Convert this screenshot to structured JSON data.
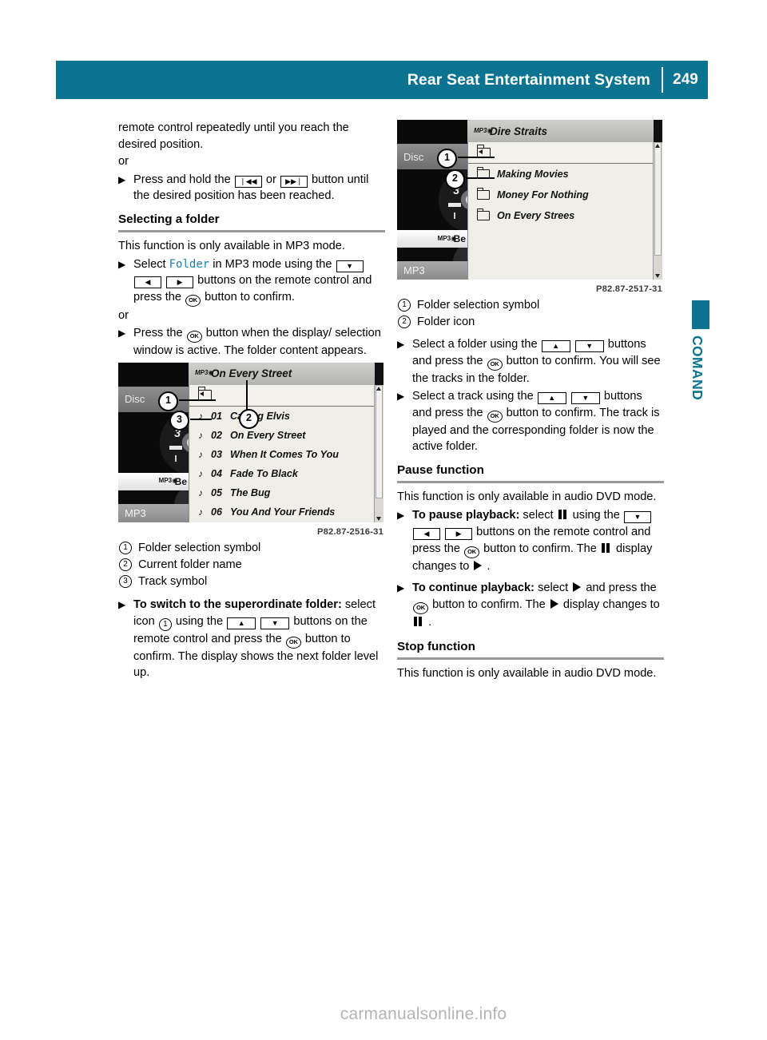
{
  "header": {
    "title": "Rear Seat Entertainment System",
    "page_number": "249",
    "accent_color": "#0c7490"
  },
  "side_tab": {
    "label": "COMAND"
  },
  "left_column": {
    "continued_paragraph": "remote control repeatedly until you reach the desired position.",
    "or_1": "or",
    "bullet_1": {
      "pre": "Press and hold the",
      "key_prev": "❘◀◀",
      "mid": "or",
      "key_next": "▶▶❘",
      "post": "button until the desired position has been reached."
    },
    "section_title": "Selecting a folder",
    "intro": "This function is only available in MP3 mode.",
    "bullet_2": {
      "pre": "Select",
      "menu_item": "Folder",
      "mid": "in MP3 mode using the",
      "key_down": "▼",
      "key_left": "◀",
      "key_right": "▶",
      "post": "buttons on the remote control and press the",
      "ok": "OK",
      "tail": "button to confirm."
    },
    "or_2": "or",
    "bullet_3": {
      "pre": "Press the",
      "ok": "OK",
      "post": "button when the display/ selection window is active.",
      "result": "The folder content appears."
    },
    "legend": [
      {
        "num": "1",
        "text": "Folder selection symbol"
      },
      {
        "num": "2",
        "text": "Current folder name"
      },
      {
        "num": "3",
        "text": "Track symbol"
      }
    ],
    "bullet_4": {
      "bold": "To switch to the superordinate folder:",
      "pre": "select icon",
      "icon_num": "1",
      "mid": "using the",
      "key_up": "▲",
      "key_down": "▼",
      "post": "buttons on the remote control and press the",
      "ok": "OK",
      "tail": "button to confirm.",
      "result": "The display shows the next folder level up."
    }
  },
  "screenshot_1": {
    "caption": "P82.87-2516-31",
    "strip": {
      "disc_label": "Disc",
      "track_digit": "3",
      "mp3_row_text": "Be",
      "mode_label": "MP3"
    },
    "titlebar": {
      "icon": "mp3-disc-icon",
      "text": "On Every Street"
    },
    "folder_up_icon": "folder-up-icon",
    "tracks": [
      {
        "num": "01",
        "name": "Calling Elvis"
      },
      {
        "num": "02",
        "name": "On Every Street"
      },
      {
        "num": "03",
        "name": "When It Comes To You"
      },
      {
        "num": "04",
        "name": "Fade To Black"
      },
      {
        "num": "05",
        "name": "The Bug"
      },
      {
        "num": "06",
        "name": "You And Your Friends"
      }
    ],
    "callouts": [
      "1",
      "2",
      "3"
    ]
  },
  "screenshot_2": {
    "caption": "P82.87-2517-31",
    "strip": {
      "disc_label": "Disc",
      "track_digit": "3",
      "mp3_row_text": "Be",
      "mode_label": "MP3"
    },
    "titlebar": {
      "icon": "mp3-disc-icon",
      "text": "Dire Straits"
    },
    "folder_up_icon": "folder-up-icon",
    "folders": [
      {
        "name": "Making Movies"
      },
      {
        "name": "Money For Nothing"
      },
      {
        "name": "On Every Strees"
      }
    ],
    "callouts": [
      "1",
      "2"
    ]
  },
  "right_column": {
    "legend": [
      {
        "num": "1",
        "text": "Folder selection symbol"
      },
      {
        "num": "2",
        "text": "Folder icon"
      }
    ],
    "bullet_1": {
      "pre": "Select a folder using the",
      "key_up": "▲",
      "key_down": "▼",
      "post": "buttons and press the",
      "ok": "OK",
      "tail": "button to confirm.",
      "result": "You will see the tracks in the folder."
    },
    "bullet_2": {
      "pre": "Select a track using the",
      "key_up": "▲",
      "key_down": "▼",
      "post": "buttons and press the",
      "ok": "OK",
      "tail": "button to confirm.",
      "result": "The track is played and the corresponding folder is now the active folder."
    },
    "pause_section": {
      "title": "Pause function",
      "intro": "This function is only available in audio DVD mode.",
      "bullet_pause": {
        "bold": "To pause playback:",
        "pre": "select",
        "glyph": "pause-glyph",
        "mid": "using the",
        "key_down": "▼",
        "key_left": "◀",
        "key_right": "▶",
        "post": "buttons on the remote control and press the",
        "ok": "OK",
        "tail": "button to confirm.",
        "result_pre": "The",
        "result_glyph_a": "pause-glyph",
        "result_mid": "display changes to",
        "result_glyph_b": "play-glyph",
        "result_end": "."
      },
      "bullet_continue": {
        "bold": "To continue playback:",
        "pre": "select",
        "glyph": "play-glyph",
        "mid": "and press the",
        "ok": "OK",
        "tail": "button to confirm.",
        "result_pre": "The",
        "result_glyph_a": "play-glyph",
        "result_mid": "display changes to",
        "result_glyph_b": "pause-glyph",
        "result_end": "."
      }
    },
    "stop_section": {
      "title": "Stop function",
      "intro": "This function is only available in audio DVD mode."
    }
  },
  "watermark": {
    "text": "carmanualsonline.info"
  }
}
